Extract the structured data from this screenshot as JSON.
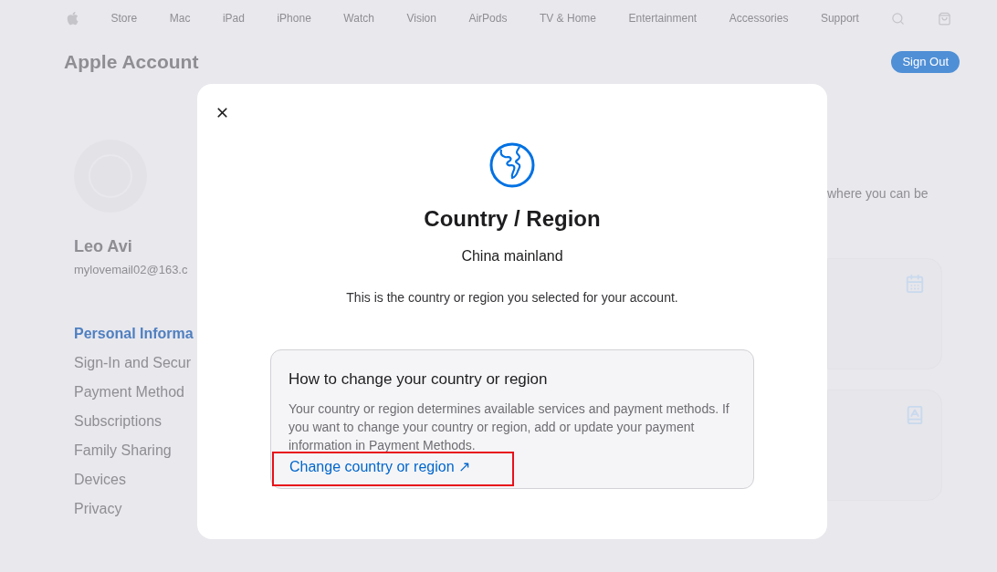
{
  "nav": {
    "items": [
      "Store",
      "Mac",
      "iPad",
      "iPhone",
      "Watch",
      "Vision",
      "AirPods",
      "TV & Home",
      "Entertainment",
      "Accessories",
      "Support"
    ]
  },
  "header": {
    "title": "Apple Account",
    "sign_out": "Sign Out"
  },
  "profile": {
    "name": "Leo Avi",
    "email": "mylovemail02@163.c"
  },
  "sidebar": {
    "items": [
      {
        "label": "Personal Informa",
        "selected": true
      },
      {
        "label": "Sign-In and Secur",
        "selected": false
      },
      {
        "label": "Payment Method",
        "selected": false
      },
      {
        "label": "Subscriptions",
        "selected": false
      },
      {
        "label": "Family Sharing",
        "selected": false
      },
      {
        "label": "Devices",
        "selected": false
      },
      {
        "label": "Privacy",
        "selected": false
      }
    ]
  },
  "content": {
    "intro": "where you can be"
  },
  "dialog": {
    "title": "Country / Region",
    "value": "China mainland",
    "description": "This is the country or region you selected for your account.",
    "info_box": {
      "heading": "How to change your country or region",
      "body": "Your country or region determines available services and payment methods. If you want to change your country or region, add or update your payment information in Payment Methods.",
      "link": {
        "label": "Change country or region ↗",
        "highlighted": true
      }
    }
  }
}
